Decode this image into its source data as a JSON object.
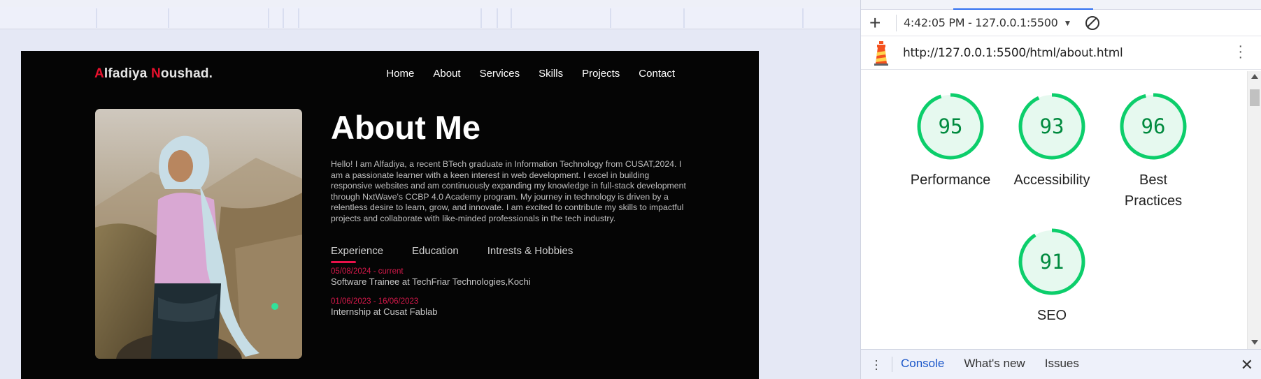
{
  "site": {
    "logo": {
      "first_initial": "A",
      "first_rest": "lfadiya ",
      "last_initial": "N",
      "last_rest": "oushad."
    },
    "nav": [
      "Home",
      "About",
      "Services",
      "Skills",
      "Projects",
      "Contact"
    ],
    "heading": "About Me",
    "bio": "Hello! I am Alfadiya, a recent BTech graduate in Information Technology from CUSAT,2024. I am a passionate learner with a keen interest in web development. I excel in building responsive websites and am continuously expanding my knowledge in full-stack development through NxtWave's CCBP 4.0 Academy program. My journey in technology is driven by a relentless desire to learn, grow, and innovate. I am excited to contribute my skills to impactful projects and collaborate with like-minded professionals in the tech industry.",
    "tabs": [
      "Experience",
      "Education",
      "Intrests & Hobbies"
    ],
    "active_tab": "Experience",
    "experience": [
      {
        "date": "05/08/2024 - current",
        "desc": "Software Trainee at TechFriar Technologies,Kochi"
      },
      {
        "date": "01/06/2023 - 16/06/2023",
        "desc": "Internship at Cusat Fablab"
      }
    ],
    "accent_color": "#e8112d"
  },
  "devtools": {
    "toolbar": {
      "add_icon": "plus-icon",
      "timestamp": "4:42:05 PM - 127.0.0.1:5500",
      "dropdown_icon": "caret-down-icon",
      "clear_icon": "block-icon"
    },
    "report_url": "http://127.0.0.1:5500/html/about.html",
    "scores": [
      {
        "label": "Performance",
        "score": "95"
      },
      {
        "label": "Accessibility",
        "score": "93"
      },
      {
        "label": "Best Practices",
        "score": "96"
      },
      {
        "label": "SEO",
        "score": "91"
      }
    ],
    "score_color": "#0cce6b",
    "drawer": {
      "tabs": [
        "Console",
        "What's new",
        "Issues"
      ],
      "active": "Console"
    }
  }
}
